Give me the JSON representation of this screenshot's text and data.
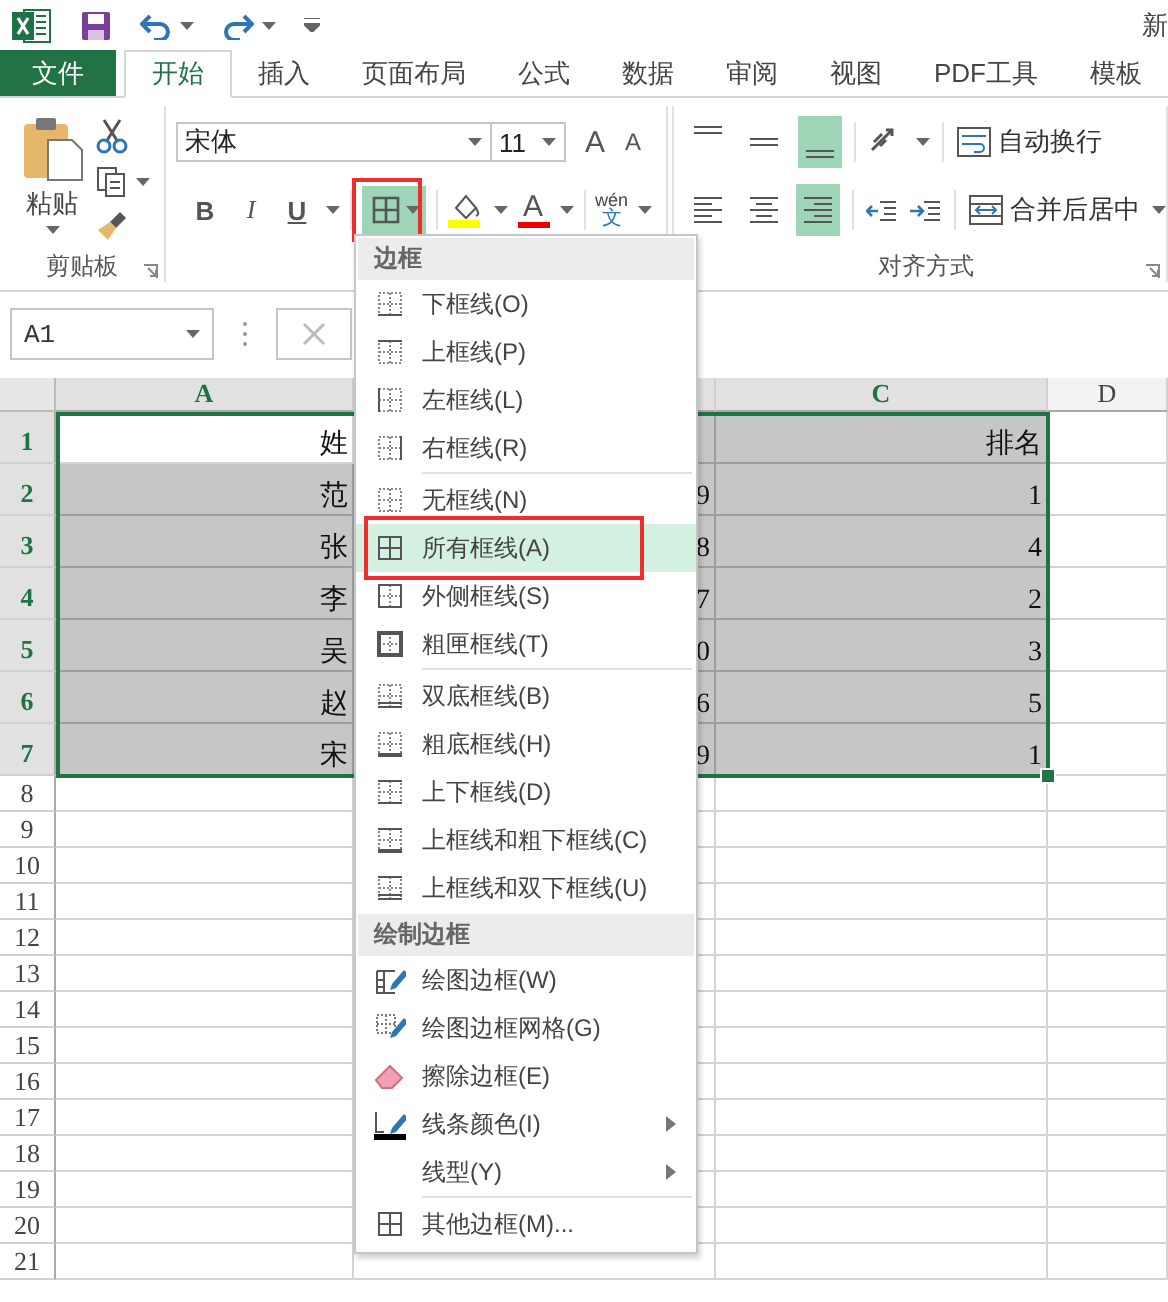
{
  "title_bar": {
    "title": "新"
  },
  "tabs": [
    {
      "label": "文件",
      "kind": "file",
      "selected": false
    },
    {
      "label": "开始",
      "kind": "tab",
      "selected": true
    },
    {
      "label": "插入",
      "kind": "tab",
      "selected": false
    },
    {
      "label": "页面布局",
      "kind": "tab",
      "selected": false
    },
    {
      "label": "公式",
      "kind": "tab",
      "selected": false
    },
    {
      "label": "数据",
      "kind": "tab",
      "selected": false
    },
    {
      "label": "审阅",
      "kind": "tab",
      "selected": false
    },
    {
      "label": "视图",
      "kind": "tab",
      "selected": false
    },
    {
      "label": "PDF工具",
      "kind": "tab",
      "selected": false
    },
    {
      "label": "模板",
      "kind": "tab",
      "selected": false
    }
  ],
  "ribbon": {
    "clipboard": {
      "paste_label": "粘贴",
      "group_label": "剪贴板"
    },
    "font": {
      "font_name": "宋体",
      "font_size": "11",
      "grow_label": "A",
      "shrink_label": "A",
      "bold_label": "B",
      "italic_label": "I",
      "underline_label": "U",
      "border_button": {
        "selected": true,
        "annotated": true
      },
      "font_color_label": "A",
      "phonetic_top": "wén",
      "phonetic_bottom": "文"
    },
    "alignment": {
      "vertical": [
        {
          "kind": "top",
          "selected": false
        },
        {
          "kind": "middle",
          "selected": false
        },
        {
          "kind": "bottom",
          "selected": true
        }
      ],
      "horizontal": [
        {
          "kind": "left",
          "selected": false
        },
        {
          "kind": "center",
          "selected": false
        },
        {
          "kind": "right",
          "selected": true
        }
      ],
      "wrap_label": "自动换行",
      "merge_label": "合并后居中",
      "group_label": "对齐方式"
    }
  },
  "name_box": {
    "value": "A1"
  },
  "sheet": {
    "columns": [
      {
        "label": "A",
        "selected": true
      },
      {
        "selected": true
      },
      {
        "label": "C",
        "selected": true
      },
      {
        "label": "D",
        "selected": false
      }
    ],
    "rows": [
      {
        "number": "1",
        "selected": true,
        "active": true,
        "a": "姓",
        "c": "排名"
      },
      {
        "number": "2",
        "selected": true,
        "a": "范",
        "b": "9",
        "c": "1"
      },
      {
        "number": "3",
        "selected": true,
        "a": "张",
        "b": "8",
        "c": "4"
      },
      {
        "number": "4",
        "selected": true,
        "a": "李",
        "b": "7",
        "c": "2"
      },
      {
        "number": "5",
        "selected": true,
        "a": "吴",
        "b": "0",
        "c": "3"
      },
      {
        "number": "6",
        "selected": true,
        "a": "赵",
        "b": "6",
        "c": "5"
      },
      {
        "number": "7",
        "selected": true,
        "a": "宋",
        "b": "9",
        "c": "1"
      },
      {
        "number": "8",
        "selected": false
      },
      {
        "number": "9",
        "selected": false
      },
      {
        "number": "10",
        "selected": false
      },
      {
        "number": "11",
        "selected": false
      },
      {
        "number": "12",
        "selected": false
      },
      {
        "number": "13",
        "selected": false
      },
      {
        "number": "14",
        "selected": false
      },
      {
        "number": "15",
        "selected": false
      },
      {
        "number": "16",
        "selected": false
      },
      {
        "number": "17",
        "selected": false
      },
      {
        "number": "18",
        "selected": false
      },
      {
        "number": "19",
        "selected": false
      },
      {
        "number": "20",
        "selected": false
      },
      {
        "number": "21",
        "selected": false
      }
    ]
  },
  "border_menu": {
    "sections": [
      {
        "title": "边框",
        "items": [
          {
            "label": "下框线(O)",
            "kind": "bottom",
            "selected": false
          },
          {
            "label": "上框线(P)",
            "kind": "top",
            "selected": false
          },
          {
            "label": "左框线(L)",
            "kind": "left",
            "selected": false
          },
          {
            "label": "右框线(R)",
            "kind": "right",
            "selected": false
          },
          {
            "label": "无框线(N)",
            "kind": "none",
            "selected": false,
            "separator_before": true
          },
          {
            "label": "所有框线(A)",
            "kind": "all",
            "selected": true,
            "annotated": true
          },
          {
            "label": "外侧框线(S)",
            "kind": "outside",
            "selected": false
          },
          {
            "label": "粗匣框线(T)",
            "kind": "thick_box",
            "selected": false
          },
          {
            "label": "双底框线(B)",
            "kind": "double_bottom",
            "selected": false,
            "separator_before": true
          },
          {
            "label": "粗底框线(H)",
            "kind": "thick_bottom",
            "selected": false
          },
          {
            "label": "上下框线(D)",
            "kind": "top_bottom",
            "selected": false
          },
          {
            "label": "上框线和粗下框线(C)",
            "kind": "top_thick_bottom",
            "selected": false
          },
          {
            "label": "上框线和双下框线(U)",
            "kind": "top_double_bottom",
            "selected": false
          }
        ]
      },
      {
        "title": "绘制边框",
        "items": [
          {
            "label": "绘图边框(W)",
            "kind": "draw",
            "selected": false
          },
          {
            "label": "绘图边框网格(G)",
            "kind": "draw_grid",
            "selected": false
          },
          {
            "label": "擦除边框(E)",
            "kind": "erase",
            "selected": false
          },
          {
            "label": "线条颜色(I)",
            "kind": "line_color",
            "selected": false,
            "submenu": true
          },
          {
            "label": "线型(Y)",
            "kind": "line_style",
            "selected": false,
            "submenu": true
          },
          {
            "label": "其他边框(M)...",
            "kind": "more",
            "selected": false,
            "separator_before": true
          }
        ]
      }
    ]
  }
}
